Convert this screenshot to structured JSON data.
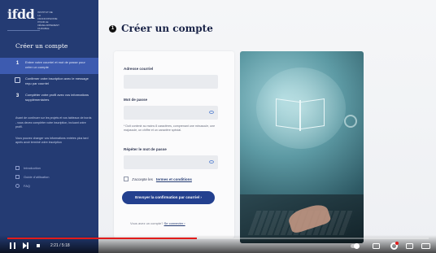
{
  "sidebar": {
    "logo_text": "ifdd",
    "logo_subtext": "INSTITUT DE LA FRANCOPHONIE POUR LE DÉVELOPPEMENT DURABLE",
    "title": "Créer un compte",
    "steps": [
      {
        "num": "1",
        "label": "Entrer votre courriel et mot de passe pour créer un compte"
      },
      {
        "num": "",
        "label": "Confirmer votre inscription avec le message reçu par courriel"
      },
      {
        "num": "3",
        "label": "Compléter votre profil avec vos informations supplémentaires"
      }
    ],
    "notes": [
      "Avant de continuer sur les projets et vos tableaux de bords - vous devez compléter votre inscription, incluant votre profil.",
      "Vous pouvez changer vos informations entrées plus tard après avoir terminé votre inscription"
    ],
    "links": [
      {
        "label": "Introduction",
        "icon": "play-icon"
      },
      {
        "label": "Guide d'utilisation",
        "icon": "book-icon"
      },
      {
        "label": "FAQ",
        "icon": "help-icon"
      }
    ]
  },
  "main": {
    "step_badge": "1",
    "title": "Créer un compte",
    "form": {
      "email_label": "Adresse courriel",
      "password_label": "Mot de passe",
      "password_hint": "* Doit contenir au moins 8 caractères, comprenant une minuscule, une majuscule, un chiffre et un caractère spécial.",
      "repeat_label": "Répéter le mot de passe",
      "terms_prefix": "J'accepte les",
      "terms_link": "termes et conditions",
      "submit_label": "Envoyer la confirmation par courriel ›",
      "login_prefix": "Vous avez un compte?",
      "login_link": "Se connecter ›"
    }
  },
  "video": {
    "time": "2:21 / 5:18",
    "progress": 0.45,
    "accent": "#e21b1b"
  }
}
